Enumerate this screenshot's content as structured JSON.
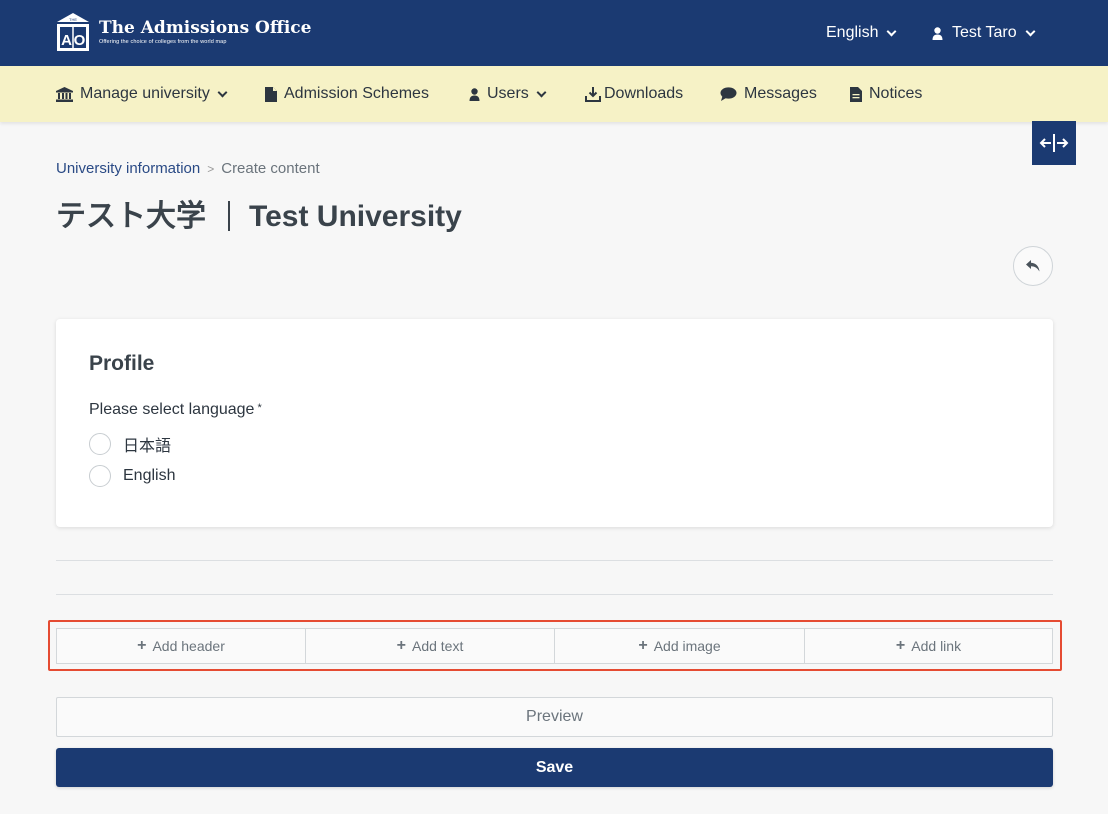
{
  "header": {
    "brand_title": "The Admissions Office",
    "brand_tagline": "Offering the choice of colleges from the world map",
    "logo_letters": "AO",
    "logo_sign": "THE",
    "language": "English",
    "user": "Test Taro",
    "colors": {
      "primary": "#1b3a72",
      "subnav": "#f6f2c6",
      "highlight": "#e54b32"
    }
  },
  "nav": {
    "items": [
      {
        "label": "Manage university",
        "icon": "university-icon",
        "dropdown": true
      },
      {
        "label": "Admission Schemes",
        "icon": "file-icon",
        "dropdown": false
      },
      {
        "label": "Users",
        "icon": "user-icon",
        "dropdown": true
      },
      {
        "label": "Downloads",
        "icon": "download-icon",
        "dropdown": false
      },
      {
        "label": "Messages",
        "icon": "comment-icon",
        "dropdown": false
      },
      {
        "label": "Notices",
        "icon": "document-icon",
        "dropdown": false
      }
    ]
  },
  "breadcrumb": {
    "link": "University information",
    "separator": ">",
    "current": "Create content"
  },
  "page": {
    "title_ja": "テスト大学",
    "title_en": "Test University"
  },
  "profile": {
    "title": "Profile",
    "language_label": "Please select language",
    "required_mark": "*",
    "options": [
      "日本語",
      "English"
    ]
  },
  "toolbar": {
    "add_header": "Add header",
    "add_text": "Add text",
    "add_image": "Add image",
    "add_link": "Add link",
    "plus": "+"
  },
  "actions": {
    "preview": "Preview",
    "save": "Save"
  }
}
